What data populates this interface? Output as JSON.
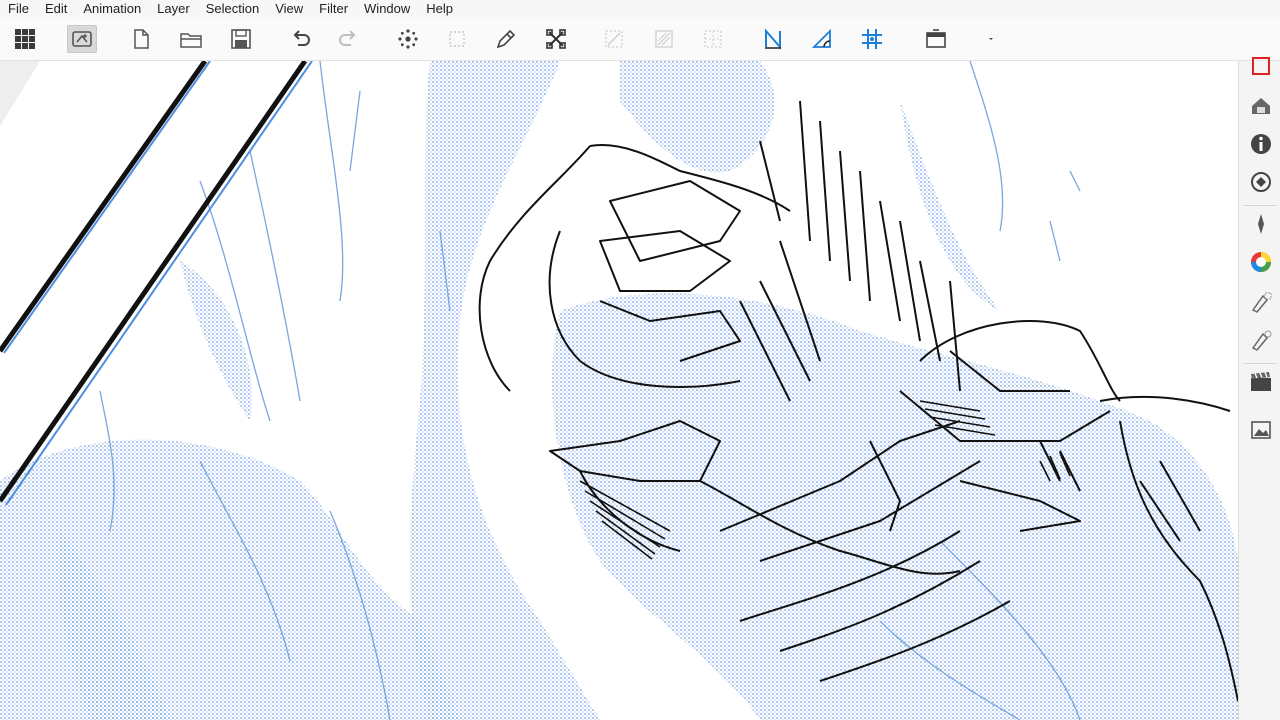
{
  "menu": {
    "items": [
      "File",
      "Edit",
      "Animation",
      "Layer",
      "Selection",
      "View",
      "Filter",
      "Window",
      "Help"
    ]
  },
  "toolbar": {
    "buttons": [
      {
        "icon": "grid-menu-icon",
        "state": "normal"
      },
      {
        "icon": "transform-preview-icon",
        "state": "active"
      },
      {
        "icon": "new-file-icon",
        "state": "normal"
      },
      {
        "icon": "open-folder-icon",
        "state": "normal"
      },
      {
        "icon": "save-icon",
        "state": "normal"
      },
      {
        "icon": "undo-icon",
        "state": "normal"
      },
      {
        "icon": "redo-icon",
        "state": "disabled"
      },
      {
        "icon": "selection-spread-icon",
        "state": "normal"
      },
      {
        "icon": "deselect-icon",
        "state": "disabled"
      },
      {
        "icon": "pen-correction-icon",
        "state": "normal"
      },
      {
        "icon": "transform-icon",
        "state": "normal"
      },
      {
        "icon": "cut-icon",
        "state": "disabled"
      },
      {
        "icon": "fill-icon",
        "state": "disabled"
      },
      {
        "icon": "grid-snap-icon",
        "state": "disabled"
      },
      {
        "icon": "snap-ruler-icon",
        "state": "normal"
      },
      {
        "icon": "snap-special-ruler-icon",
        "state": "normal"
      },
      {
        "icon": "snap-grid-icon",
        "state": "normal"
      },
      {
        "icon": "workspace-icon",
        "state": "normal"
      },
      {
        "icon": "dropdown-arrow-icon",
        "state": "normal"
      }
    ]
  },
  "sidepanel": {
    "buttons": [
      "canvas-frame-icon",
      "material-icon",
      "layer-property-icon",
      "navigator-icon",
      "pen-tool-icon",
      "color-wheel-icon",
      "sub-tool-icon",
      "brush-size-icon",
      "timeline-icon",
      "image-icon"
    ]
  },
  "colors": {
    "accent": "#2f7bd8",
    "sketch_blue": "#6a9ddb",
    "ink": "#111111",
    "snap_active": "#1d7fd8"
  }
}
